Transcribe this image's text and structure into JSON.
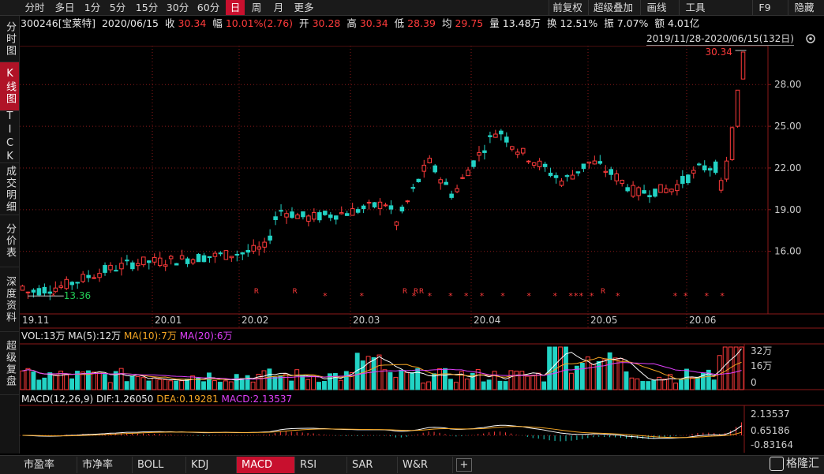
{
  "toolbar": {
    "timeframes": [
      "分时",
      "多日",
      "1分",
      "5分",
      "15分",
      "30分",
      "60分",
      "日",
      "周",
      "月",
      "更多"
    ],
    "active": "日",
    "right": [
      "前复权",
      "超级叠加",
      "画线",
      "工具",
      "F9",
      "隐藏"
    ]
  },
  "left_tabs": [
    "分时图",
    "K线图",
    "TICK",
    "成交明细",
    "分价表",
    "深度资料",
    "超级复盘"
  ],
  "left_active": "K线图",
  "info": {
    "code": "300246[宝莱特]",
    "date": "2020/06/15",
    "close_label": "收",
    "close": "30.34",
    "chg_label": "幅",
    "chg": "10.01%(2.76)",
    "open_label": "开",
    "open": "30.28",
    "high_label": "高",
    "high": "30.34",
    "low_label": "低",
    "low": "28.39",
    "avg_label": "均",
    "avg": "29.75",
    "vol_label": "量",
    "vol": "13.48万",
    "turn_label": "换",
    "turn": "12.51%",
    "amp_label": "振",
    "amp": "7.07%",
    "amt_label": "额",
    "amt": "4.01亿"
  },
  "range": "2019/11/28-2020/06/15(132日)",
  "colors": {
    "up": "#ff3b3b",
    "down": "#22d3c5",
    "ma5": "#ffffff",
    "ma10": "#f5a623",
    "ma20": "#e040fb",
    "grid": "#8b1a1a",
    "bg": "#000000"
  },
  "vol_legend": {
    "a": "VOL:13万",
    "b": "MA(5):12万",
    "c": "MA(10):7万",
    "d": "MA(20):6万"
  },
  "macd_legend": {
    "a": "MACD(12,26,9)",
    "b": "DIF:1.26050",
    "c": "DEA:0.19281",
    "d": "MACD:2.13537"
  },
  "bottom_tabs": [
    "市盈率",
    "市净率",
    "BOLL",
    "KDJ",
    "MACD",
    "RSI",
    "SAR",
    "W&R"
  ],
  "bottom_active": "MACD",
  "logo": "格隆汇",
  "chart_data": [
    {
      "type": "candlestick",
      "x_ticks": [
        "19.11",
        "20.01",
        "20.02",
        "20.03",
        "20.04",
        "20.05",
        "20.06"
      ],
      "y_ticks": [
        28.0,
        25.0,
        22.0,
        19.0,
        16.0
      ],
      "ylim": [
        11.5,
        30.34
      ],
      "annotations": {
        "high": "30.34",
        "low": "13.36"
      },
      "markers_r": [
        0,
        0,
        0,
        0,
        0,
        0,
        0,
        0,
        0,
        0,
        0,
        0,
        0,
        0,
        0,
        0,
        0,
        0,
        0,
        0,
        0,
        0,
        0,
        0,
        0,
        0,
        0,
        0,
        0,
        0,
        0,
        0,
        0,
        0,
        0,
        0,
        0,
        0,
        0,
        0,
        0,
        0,
        0,
        0,
        0,
        0,
        0,
        0,
        0,
        0,
        0,
        0,
        0,
        0,
        0,
        0,
        0,
        0,
        0,
        0,
        0,
        0,
        0,
        0,
        0,
        0,
        0,
        0,
        0,
        0,
        0,
        0,
        0,
        0,
        0,
        0,
        0,
        0,
        0,
        0,
        0,
        0,
        0,
        0,
        0,
        0,
        0,
        0,
        0,
        0,
        0,
        0,
        0,
        0,
        0,
        0,
        0,
        0,
        0,
        0,
        0,
        0,
        0,
        0,
        0,
        0,
        0,
        0,
        0,
        0,
        0,
        0,
        0,
        0,
        0,
        0,
        0,
        0,
        0,
        0,
        0,
        0,
        0,
        0,
        0,
        0,
        0,
        0,
        0,
        0,
        0,
        0
      ]
    },
    {
      "type": "bar",
      "name": "volume",
      "y_ticks": [
        "32万",
        "16万",
        "0"
      ]
    },
    {
      "type": "bar",
      "name": "macd",
      "y_ticks": [
        "2.13537",
        "0.65186",
        "-0.83164"
      ]
    }
  ]
}
